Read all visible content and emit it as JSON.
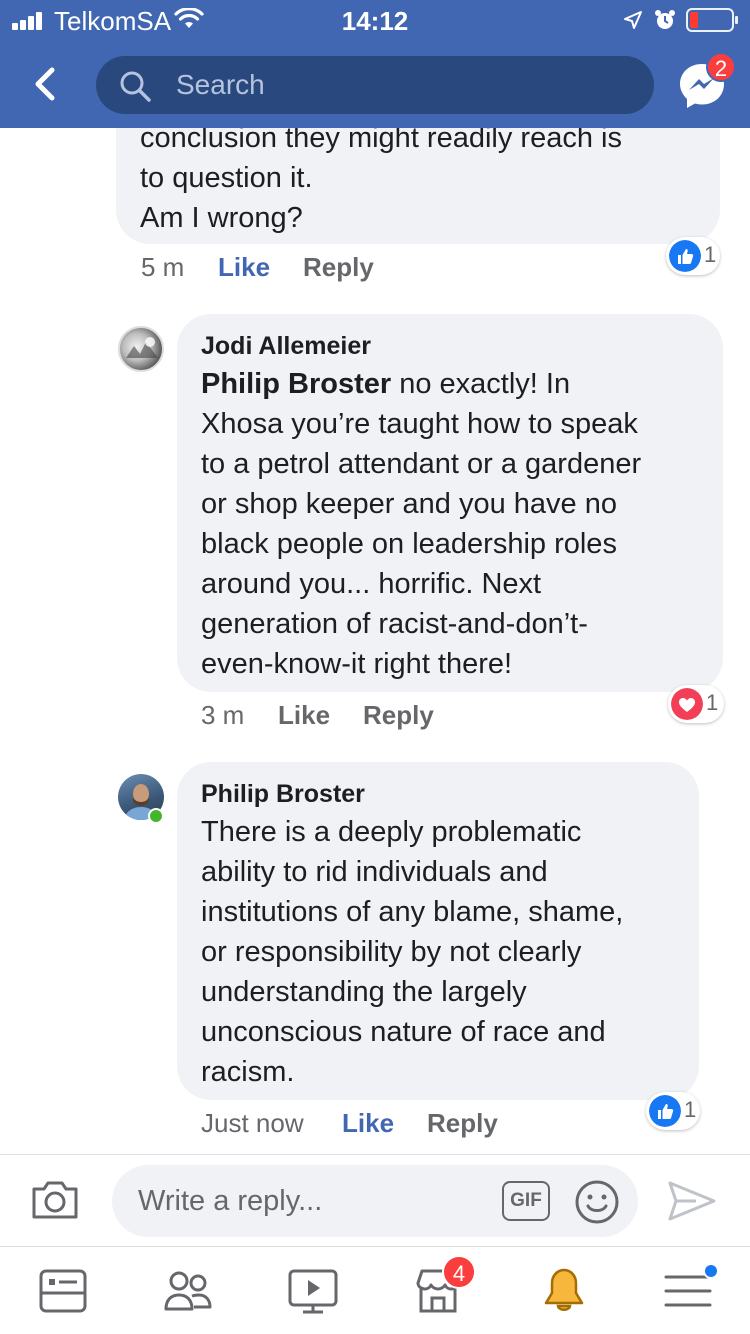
{
  "status_bar": {
    "carrier": "TelkomSA",
    "time": "14:12",
    "battery_level": 0.2
  },
  "header": {
    "search_placeholder": "Search",
    "messenger_badge": "2"
  },
  "comments": [
    {
      "author": "",
      "text_lines": [
        "conclusion they might readily reach is",
        "to question it.",
        "Am I wrong?"
      ],
      "time": "5 m",
      "like_label": "Like",
      "like_active": true,
      "reply_label": "Reply",
      "reaction": {
        "type": "like-icon",
        "count": "1"
      }
    },
    {
      "author": "Jodi Allemeier",
      "mention": "Philip Broster",
      "text_lines": [
        " no exactly! In",
        "Xhosa you’re taught how to speak",
        "to a petrol attendant or a gardener",
        "or shop keeper and you have no",
        "black people on leadership roles",
        "around you... horrific. Next",
        "generation of racist-and-don’t-",
        "even-know-it right there!"
      ],
      "time": "3 m",
      "like_label": "Like",
      "like_active": false,
      "reply_label": "Reply",
      "reaction": {
        "type": "love-icon",
        "count": "1"
      }
    },
    {
      "author": "Philip Broster",
      "text_lines": [
        "There is a deeply problematic",
        "ability to rid individuals and",
        "institutions of any blame, shame,",
        "or responsibility by not clearly",
        "understanding the largely",
        "unconscious nature of race and",
        "racism."
      ],
      "time": "Just now",
      "like_label": "Like",
      "like_active": true,
      "reply_label": "Reply",
      "reaction": {
        "type": "like-icon",
        "count": "1"
      },
      "online": true
    }
  ],
  "composer": {
    "placeholder": "Write a reply...",
    "gif_label": "GIF"
  },
  "tabbar": {
    "marketplace_badge": "4"
  },
  "colors": {
    "brand": "#4267b2",
    "bubble": "#f0f2f5",
    "love": "#f33e58",
    "badge": "#fa3e3e"
  }
}
